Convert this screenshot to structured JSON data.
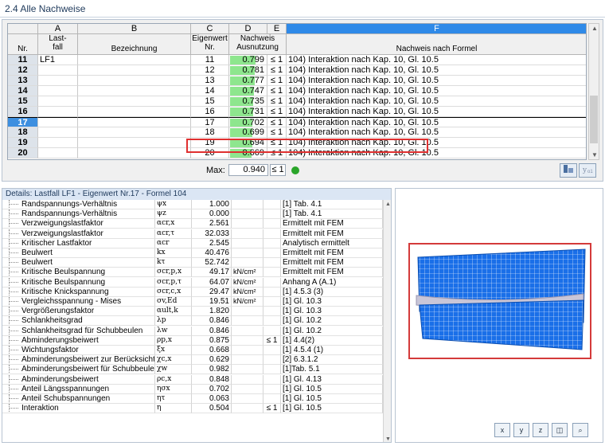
{
  "window": {
    "title": "2.4 Alle Nachweise"
  },
  "table": {
    "col_letters": [
      "A",
      "B",
      "C",
      "D",
      "E",
      "F"
    ],
    "headers": {
      "nr": "Nr.",
      "lastfall_1": "Last-",
      "lastfall_2": "fall",
      "bezeichnung": "Bezeichnung",
      "eigenwert_1": "Eigenwert",
      "eigenwert_2": "Nr.",
      "nachweis_1": "Nachweis",
      "nachweis_2": "Ausnutzung",
      "formel": "Nachweis nach Formel"
    },
    "rows": [
      {
        "nr": "11",
        "lastfall": "LF1",
        "bezeichnung": "",
        "eigenwert": "11",
        "ausnutzung": "0.799",
        "le": "≤ 1",
        "formel": "104) Interaktion nach Kap. 10, Gl. 10.5",
        "util": 0.799
      },
      {
        "nr": "12",
        "lastfall": "",
        "bezeichnung": "",
        "eigenwert": "12",
        "ausnutzung": "0.781",
        "le": "≤ 1",
        "formel": "104) Interaktion nach Kap. 10, Gl. 10.5",
        "util": 0.781
      },
      {
        "nr": "13",
        "lastfall": "",
        "bezeichnung": "",
        "eigenwert": "13",
        "ausnutzung": "0.777",
        "le": "≤ 1",
        "formel": "104) Interaktion nach Kap. 10, Gl. 10.5",
        "util": 0.777
      },
      {
        "nr": "14",
        "lastfall": "",
        "bezeichnung": "",
        "eigenwert": "14",
        "ausnutzung": "0.747",
        "le": "≤ 1",
        "formel": "104) Interaktion nach Kap. 10, Gl. 10.5",
        "util": 0.747
      },
      {
        "nr": "15",
        "lastfall": "",
        "bezeichnung": "",
        "eigenwert": "15",
        "ausnutzung": "0.735",
        "le": "≤ 1",
        "formel": "104) Interaktion nach Kap. 10, Gl. 10.5",
        "util": 0.735
      },
      {
        "nr": "16",
        "lastfall": "",
        "bezeichnung": "",
        "eigenwert": "16",
        "ausnutzung": "0.731",
        "le": "≤ 1",
        "formel": "104) Interaktion nach Kap. 10, Gl. 10.5",
        "util": 0.731
      },
      {
        "nr": "17",
        "lastfall": "",
        "bezeichnung": "",
        "eigenwert": "17",
        "ausnutzung": "0.702",
        "le": "≤ 1",
        "formel": "104) Interaktion nach Kap. 10, Gl. 10.5",
        "util": 0.702
      },
      {
        "nr": "18",
        "lastfall": "",
        "bezeichnung": "",
        "eigenwert": "18",
        "ausnutzung": "0.699",
        "le": "≤ 1",
        "formel": "104) Interaktion nach Kap. 10, Gl. 10.5",
        "util": 0.699
      },
      {
        "nr": "19",
        "lastfall": "",
        "bezeichnung": "",
        "eigenwert": "19",
        "ausnutzung": "0.694",
        "le": "≤ 1",
        "formel": "104) Interaktion nach Kap. 10, Gl. 10.5",
        "util": 0.694
      },
      {
        "nr": "20",
        "lastfall": "",
        "bezeichnung": "",
        "eigenwert": "20",
        "ausnutzung": "0.669",
        "le": "≤ 1",
        "formel": "104) Interaktion nach Kap. 10, Gl. 10.5",
        "util": 0.669
      }
    ],
    "selected_nr": "17",
    "max_label": "Max:",
    "max_value": "0.940",
    "max_le": "≤ 1"
  },
  "details": {
    "title": "Details: Lastfall LF1 - Eigenwert Nr.17 - Formel 104",
    "rows": [
      {
        "name": "Randspannungs-Verhältnis",
        "symbol": "ψx",
        "value": "1.000",
        "unit": "",
        "le": "",
        "ref": "[1] Tab. 4.1"
      },
      {
        "name": "Randspannungs-Verhältnis",
        "symbol": "ψz",
        "value": "0.000",
        "unit": "",
        "le": "",
        "ref": "[1] Tab. 4.1"
      },
      {
        "name": "Verzweigungslastfaktor",
        "symbol": "αcr,x",
        "value": "2.561",
        "unit": "",
        "le": "",
        "ref": "Ermittelt mit FEM"
      },
      {
        "name": "Verzweigungslastfaktor",
        "symbol": "αcr,τ",
        "value": "32.033",
        "unit": "",
        "le": "",
        "ref": "Ermittelt mit FEM"
      },
      {
        "name": "Kritischer Lastfaktor",
        "symbol": "αcr",
        "value": "2.545",
        "unit": "",
        "le": "",
        "ref": "Analytisch ermittelt"
      },
      {
        "name": "Beulwert",
        "symbol": "kx",
        "value": "40.476",
        "unit": "",
        "le": "",
        "ref": "Ermittelt mit FEM"
      },
      {
        "name": "Beulwert",
        "symbol": "kτ",
        "value": "52.742",
        "unit": "",
        "le": "",
        "ref": "Ermittelt mit FEM"
      },
      {
        "name": "Kritische Beulspannung",
        "symbol": "σcr,p,x",
        "value": "49.17",
        "unit": "kN/cm²",
        "le": "",
        "ref": "Ermittelt mit FEM"
      },
      {
        "name": "Kritische Beulspannung",
        "symbol": "σcr,p,τ",
        "value": "64.07",
        "unit": "kN/cm²",
        "le": "",
        "ref": "Anhang A (A.1)"
      },
      {
        "name": "Kritische Knickspannung",
        "symbol": "σcr,c,x",
        "value": "29.47",
        "unit": "kN/cm²",
        "le": "",
        "ref": "[1] 4.5.3 (3)"
      },
      {
        "name": "Vergleichsspannung - Mises",
        "symbol": "σv,Ed",
        "value": "19.51",
        "unit": "kN/cm²",
        "le": "",
        "ref": "[1] Gl. 10.3"
      },
      {
        "name": "Vergrößerungsfaktor",
        "symbol": "αult,k",
        "value": "1.820",
        "unit": "",
        "le": "",
        "ref": "[1] Gl. 10.3"
      },
      {
        "name": "Schlankheitsgrad",
        "symbol": "λp",
        "value": "0.846",
        "unit": "",
        "le": "",
        "ref": "[1] Gl. 10.2"
      },
      {
        "name": "Schlankheitsgrad für Schubbeulen",
        "symbol": "λw",
        "value": "0.846",
        "unit": "",
        "le": "",
        "ref": "[1] Gl. 10.2"
      },
      {
        "name": "Abminderungsbeiwert",
        "symbol": "ρp,x",
        "value": "0.875",
        "unit": "",
        "le": "≤ 1",
        "ref": "[1] 4.4(2)"
      },
      {
        "name": "Wichtungsfaktor",
        "symbol": "ξx",
        "value": "0.668",
        "unit": "",
        "le": "",
        "ref": "[1] 4.5.4 (1)"
      },
      {
        "name": "Abminderungsbeiwert zur Berücksichtigu",
        "symbol": "χc,x",
        "value": "0.629",
        "unit": "",
        "le": "",
        "ref": "[2] 6.3.1.2"
      },
      {
        "name": "Abminderungsbeiwert für Schubbeulen",
        "symbol": "χw",
        "value": "0.982",
        "unit": "",
        "le": "",
        "ref": "[1]Tab. 5.1"
      },
      {
        "name": "Abminderungsbeiwert",
        "symbol": "ρc,x",
        "value": "0.848",
        "unit": "",
        "le": "",
        "ref": "[1] Gl. 4.13"
      },
      {
        "name": "Anteil Längsspannungen",
        "symbol": "ησx",
        "value": "0.702",
        "unit": "",
        "le": "",
        "ref": "[1] Gl. 10.5"
      },
      {
        "name": "Anteil Schubspannungen",
        "symbol": "ητ",
        "value": "0.063",
        "unit": "",
        "le": "",
        "ref": "[1] Gl. 10.5"
      },
      {
        "name": "Interaktion",
        "symbol": "η",
        "value": "0.504",
        "unit": "",
        "le": "≤ 1",
        "ref": "[1] Gl. 10.5"
      }
    ]
  },
  "colors": {
    "selection": "#3d8fe0",
    "util_bar": "#8ee68e",
    "highlight": "#e03030",
    "mesh": "#1a6fe8"
  },
  "icons": {
    "table_buttons": [
      "filter-icon",
      "result-diagram-icon"
    ],
    "graphic_tools": [
      "view-x-icon",
      "view-y-icon",
      "view-z-icon",
      "iso-view-icon",
      "zoom-icon"
    ]
  }
}
